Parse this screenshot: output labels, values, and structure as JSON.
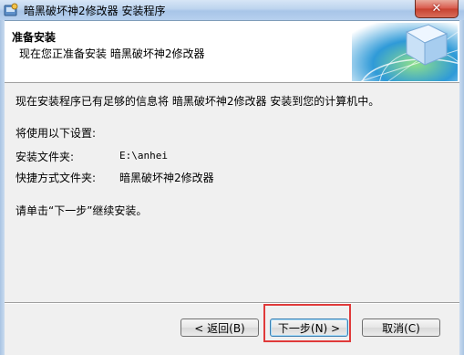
{
  "window": {
    "title": "暗黑破坏神2修改器 安装程序",
    "close_glyph": "✕"
  },
  "header": {
    "title": "准备安装",
    "subtitle": "现在您正准备安装 暗黑破坏神2修改器"
  },
  "body": {
    "intro": "现在安装程序已有足够的信息将 暗黑破坏神2修改器 安装到您的计算机中。",
    "settings_heading": "将使用以下设置:",
    "install_folder_label": "安装文件夹:",
    "install_folder_value": "E:\\anhei",
    "shortcut_folder_label": "快捷方式文件夹:",
    "shortcut_folder_value": "暗黑破坏神2修改器",
    "continue_prompt": "请单击“下一步”继续安装。"
  },
  "buttons": {
    "back": "< 返回(B)",
    "next": "下一步(N) >",
    "cancel": "取消(C)"
  },
  "colors": {
    "highlight": "#e03a3a",
    "close_button": "#c7412f"
  }
}
